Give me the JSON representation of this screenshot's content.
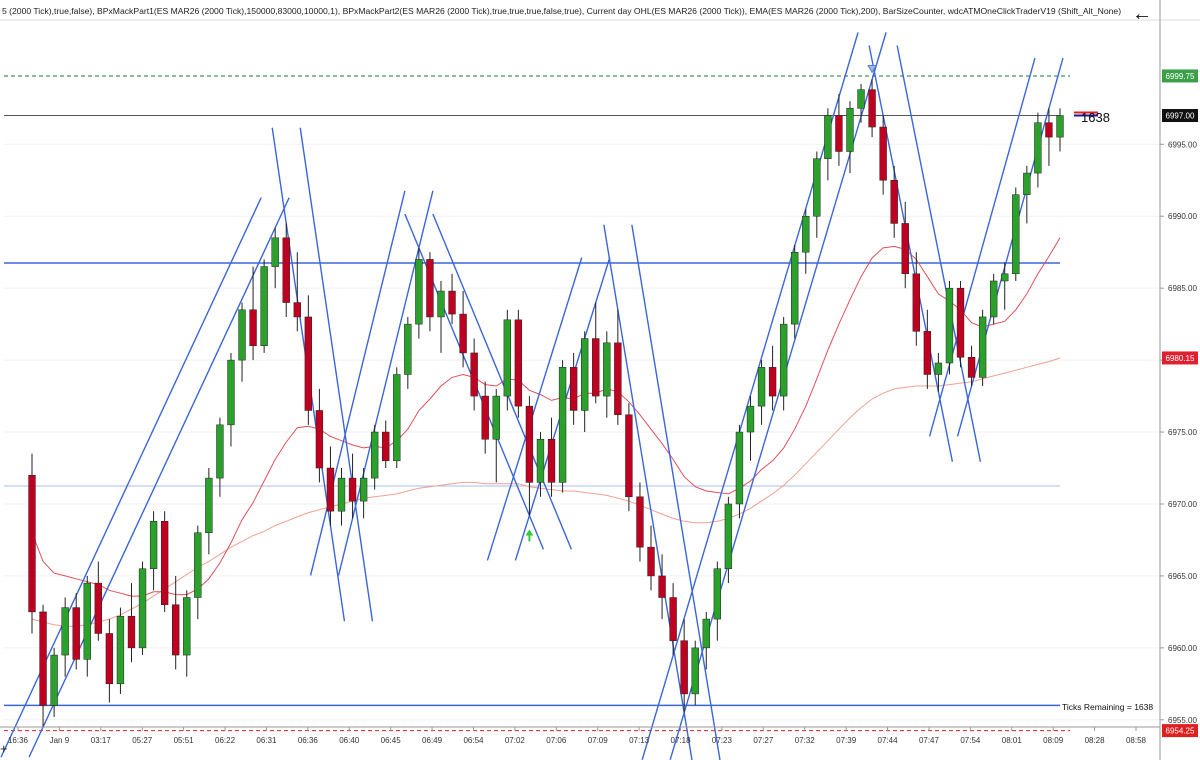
{
  "header": {
    "indicators_text": "5 (2000 Tick),true,false), BPxMackPart1(ES MAR26 (2000 Tick),150000,83000,10000,1), BPxMackPart2(ES MAR26 (2000 Tick),true,true,true,false,true), Current day OHL(ES MAR26 (2000 Tick)), EMA(ES MAR26 (2000 Tick),200), BarSizeCounter, wdcATMOneClickTraderV19 (Shift_Alt_None)"
  },
  "nav": {
    "back_icon": "arrow-left-icon",
    "back_glyph": "←"
  },
  "corner": {
    "glyph": "+"
  },
  "bar_counter": {
    "value": "1638",
    "ticks_remaining_text": "Ticks Remaining = 1638"
  },
  "colors": {
    "up_candle": "#2ca02c",
    "down_candle": "#c00020",
    "wick": "#222222",
    "trend_line": "#3a66d8",
    "ema_fast": "#e0505a",
    "ema_slow": "#f0a090",
    "level_green": "#1a7a2a",
    "level_red": "#e02020",
    "last_price_bg": "#111111",
    "high_label_bg": "#3aa048",
    "low_label_bg": "#e02020",
    "ema_label_bg": "#e02030"
  },
  "chart_data": {
    "type": "candlestick",
    "instrument": "ES MAR26 (2000 Tick)",
    "ylim": [
      6954.5,
      7003.5
    ],
    "y_ticks": [
      6955,
      6960,
      6965,
      6970,
      6975,
      6980,
      6985,
      6990,
      6995
    ],
    "y_tick_labels": [
      "6955.00",
      "6960.00",
      "6965.00",
      "6970.00",
      "6975.00",
      "6980.00",
      "6985.00",
      "6990.00",
      "6995.00"
    ],
    "x_labels": [
      "16:36",
      "Jan 9",
      "03:17",
      "05:27",
      "05:51",
      "06:22",
      "06:31",
      "06:36",
      "06:40",
      "06:45",
      "06:49",
      "06:54",
      "07:02",
      "07:06",
      "07:09",
      "07:13",
      "07:18",
      "07:23",
      "07:27",
      "07:32",
      "07:39",
      "07:44",
      "07:47",
      "07:54",
      "08:01",
      "08:09",
      "08:28",
      "08:58"
    ],
    "price_labels": [
      {
        "value": 6999.75,
        "text": "6999.75",
        "kind": "high"
      },
      {
        "value": 6997.0,
        "text": "6997.00",
        "kind": "last"
      },
      {
        "value": 6980.15,
        "text": "6980.15",
        "kind": "ema"
      },
      {
        "value": 6954.25,
        "text": "6954.25",
        "kind": "low"
      }
    ],
    "horizontal_levels": [
      {
        "value": 6997.0,
        "color": "#555555",
        "style": "solid"
      },
      {
        "value": 6999.75,
        "color": "#1a7a2a",
        "style": "dashed"
      },
      {
        "value": 6954.25,
        "color": "#e02020",
        "style": "dashed"
      },
      {
        "value": 6986.75,
        "color": "#3a66d8",
        "style": "solid"
      },
      {
        "value": 6956.0,
        "color": "#3a66d8",
        "style": "solid"
      },
      {
        "value": 6971.25,
        "color": "#a8bce8",
        "style": "solid"
      }
    ],
    "candles": [
      [
        6972,
        6973.5,
        6961,
        6962.5
      ],
      [
        6962.5,
        6963,
        6954.5,
        6956
      ],
      [
        6956,
        6960,
        6955.2,
        6959.5
      ],
      [
        6959.5,
        6963.5,
        6958,
        6962.8
      ],
      [
        6962.8,
        6963.8,
        6958.5,
        6959.2
      ],
      [
        6959.2,
        6965,
        6958,
        6964.5
      ],
      [
        6964.5,
        6966,
        6960.5,
        6961
      ],
      [
        6961,
        6962,
        6956.2,
        6957.5
      ],
      [
        6957.5,
        6962.8,
        6956.8,
        6962.2
      ],
      [
        6962.2,
        6964.5,
        6959,
        6960
      ],
      [
        6960,
        6966,
        6959.5,
        6965.5
      ],
      [
        6965.5,
        6969.5,
        6964,
        6968.8
      ],
      [
        6968.8,
        6969.5,
        6962.5,
        6963
      ],
      [
        6963,
        6965,
        6958.5,
        6959.5
      ],
      [
        6959.5,
        6964,
        6958,
        6963.5
      ],
      [
        6963.5,
        6968.5,
        6962,
        6968
      ],
      [
        6968,
        6972.5,
        6966.5,
        6971.8
      ],
      [
        6971.8,
        6976,
        6970.5,
        6975.5
      ],
      [
        6975.5,
        6980.5,
        6974,
        6980
      ],
      [
        6980,
        6984,
        6978.5,
        6983.5
      ],
      [
        6983.5,
        6986.5,
        6980,
        6981
      ],
      [
        6981,
        6987,
        6980.5,
        6986.5
      ],
      [
        6986.5,
        6989.2,
        6985,
        6988.5
      ],
      [
        6988.5,
        6989.5,
        6983,
        6984
      ],
      [
        6984,
        6987.5,
        6982,
        6983
      ],
      [
        6983,
        6984.5,
        6975.5,
        6976.5
      ],
      [
        6976.5,
        6978,
        6971.5,
        6972.5
      ],
      [
        6972.5,
        6974,
        6968.5,
        6969.5
      ],
      [
        6969.5,
        6972.5,
        6968.5,
        6971.8
      ],
      [
        6971.8,
        6973.5,
        6969,
        6970.2
      ],
      [
        6970.2,
        6972.5,
        6969,
        6971.8
      ],
      [
        6971.8,
        6975.5,
        6971,
        6975
      ],
      [
        6975,
        6975.8,
        6972.5,
        6973
      ],
      [
        6973,
        6979.5,
        6972.5,
        6979
      ],
      [
        6979,
        6983,
        6978,
        6982.5
      ],
      [
        6982.5,
        6987.8,
        6981.5,
        6987
      ],
      [
        6987,
        6987.5,
        6982,
        6983
      ],
      [
        6983,
        6985.5,
        6980.5,
        6984.8
      ],
      [
        6984.8,
        6986,
        6982.5,
        6983.2
      ],
      [
        6983.2,
        6984.8,
        6979.5,
        6980.5
      ],
      [
        6980.5,
        6981.5,
        6976.5,
        6977.5
      ],
      [
        6977.5,
        6978.5,
        6973.5,
        6974.5
      ],
      [
        6974.5,
        6978,
        6971.5,
        6977.5
      ],
      [
        6977.5,
        6983.5,
        6976.5,
        6982.8
      ],
      [
        6982.8,
        6983.5,
        6976,
        6976.8
      ],
      [
        6976.8,
        6977.5,
        6969.2,
        6971.5
      ],
      [
        6971.5,
        6975,
        6970.5,
        6974.5
      ],
      [
        6974.5,
        6976,
        6970.5,
        6971.5
      ],
      [
        6971.5,
        6980,
        6970.8,
        6979.5
      ],
      [
        6979.5,
        6980.5,
        6975.5,
        6976.5
      ],
      [
        6976.5,
        6982,
        6975,
        6981.5
      ],
      [
        6981.5,
        6984,
        6977,
        6977.5
      ],
      [
        6977.5,
        6982,
        6976,
        6981.2
      ],
      [
        6981.2,
        6983.5,
        6975.5,
        6976.2
      ],
      [
        6976.2,
        6977,
        6969.5,
        6970.5
      ],
      [
        6970.5,
        6971.5,
        6966,
        6967
      ],
      [
        6967,
        6968.5,
        6964,
        6965
      ],
      [
        6965,
        6966.5,
        6962,
        6963.5
      ],
      [
        6963.5,
        6964.5,
        6959.5,
        6960.5
      ],
      [
        6960.5,
        6962,
        6955.5,
        6956.8
      ],
      [
        6956.8,
        6960.5,
        6956,
        6960
      ],
      [
        6960,
        6962.5,
        6958.5,
        6962
      ],
      [
        6962,
        6966,
        6960.5,
        6965.5
      ],
      [
        6965.5,
        6970.5,
        6964.5,
        6970
      ],
      [
        6970,
        6975.5,
        6969,
        6975
      ],
      [
        6975,
        6977.5,
        6973,
        6976.8
      ],
      [
        6976.8,
        6980,
        6975.5,
        6979.5
      ],
      [
        6979.5,
        6981,
        6976.5,
        6977.5
      ],
      [
        6977.5,
        6983,
        6976.5,
        6982.5
      ],
      [
        6982.5,
        6988,
        6981.5,
        6987.5
      ],
      [
        6987.5,
        6990.5,
        6986,
        6990
      ],
      [
        6990,
        6994.5,
        6988.5,
        6994
      ],
      [
        6994,
        6997.5,
        6992.5,
        6997
      ],
      [
        6997,
        6998.5,
        6993.5,
        6994.5
      ],
      [
        6994.5,
        6998,
        6993,
        6997.5
      ],
      [
        6997.5,
        6999.2,
        6996.5,
        6998.8
      ],
      [
        6998.8,
        6999.5,
        6995.5,
        6996.2
      ],
      [
        6996.2,
        6997,
        6991.5,
        6992.5
      ],
      [
        6992.5,
        6993.5,
        6988.5,
        6989.5
      ],
      [
        6989.5,
        6991,
        6985,
        6986
      ],
      [
        6986,
        6987.5,
        6981,
        6982
      ],
      [
        6982,
        6983.5,
        6978,
        6979
      ],
      [
        6979,
        6980.5,
        6977.8,
        6979.8
      ],
      [
        6979.8,
        6985.5,
        6979,
        6985
      ],
      [
        6985,
        6985.5,
        6979.5,
        6980.2
      ],
      [
        6980.2,
        6981,
        6978.2,
        6978.8
      ],
      [
        6978.8,
        6983.5,
        6978.2,
        6983
      ],
      [
        6983,
        6986,
        6982.5,
        6985.5
      ],
      [
        6985.5,
        6986.8,
        6983.5,
        6986
      ],
      [
        6986,
        6992,
        6985.5,
        6991.5
      ],
      [
        6991.5,
        6993.5,
        6989.5,
        6993
      ],
      [
        6993,
        6997.2,
        6992,
        6996.5
      ],
      [
        6996.5,
        6997.5,
        6993.5,
        6995.5
      ],
      [
        6995.5,
        6997.5,
        6994.5,
        6997
      ]
    ],
    "ema_fast": [
      6968,
      6966,
      6965.2,
      6965,
      6964.8,
      6964.6,
      6964.4,
      6964,
      6963.8,
      6963.6,
      6963.6,
      6963.9,
      6963.9,
      6963.7,
      6963.7,
      6964.1,
      6964.8,
      6965.9,
      6967.3,
      6968.9,
      6970.1,
      6971.6,
      6973.1,
      6974.3,
      6975.3,
      6975.4,
      6975.2,
      6974.7,
      6974.4,
      6974.1,
      6973.9,
      6974,
      6973.9,
      6974.4,
      6975.2,
      6976.5,
      6977.3,
      6978.2,
      6978.8,
      6979,
      6978.8,
      6978.3,
      6978.2,
      6978.7,
      6978.6,
      6977.9,
      6977.6,
      6977.2,
      6977.4,
      6977.3,
      6977.7,
      6977.7,
      6978,
      6977.8,
      6977.1,
      6976.2,
      6975.2,
      6974.2,
      6973.1,
      6971.9,
      6971.2,
      6970.9,
      6970.8,
      6970.7,
      6971.1,
      6971.6,
      6972.4,
      6973,
      6973.9,
      6975.2,
      6976.8,
      6978.7,
      6980.7,
      6982.5,
      6984.2,
      6985.8,
      6987.1,
      6987.8,
      6987.9,
      6987.7,
      6987,
      6985.8,
      6984.6,
      6984.1,
      6983.5,
      6982.6,
      6982.3,
      6982.5,
      6982.7,
      6983.5,
      6984.6,
      6986,
      6987.2,
      6988.5
    ],
    "ema_slow": [
      6962,
      6961.8,
      6961.6,
      6961.5,
      6961.5,
      6961.6,
      6961.8,
      6962,
      6962.3,
      6962.7,
      6963.1,
      6963.6,
      6964.1,
      6964.6,
      6965.1,
      6965.6,
      6966,
      6966.5,
      6967,
      6967.4,
      6967.8,
      6968.1,
      6968.5,
      6968.8,
      6969.1,
      6969.4,
      6969.6,
      6969.8,
      6970,
      6970.2,
      6970.4,
      6970.5,
      6970.6,
      6970.7,
      6970.9,
      6971.1,
      6971.2,
      6971.3,
      6971.4,
      6971.5,
      6971.5,
      6971.4,
      6971.4,
      6971.4,
      6971.4,
      6971.2,
      6971.1,
      6971,
      6970.9,
      6970.9,
      6970.8,
      6970.7,
      6970.6,
      6970.4,
      6970.2,
      6969.9,
      6969.6,
      6969.3,
      6969,
      6968.8,
      6968.7,
      6968.7,
      6968.8,
      6969,
      6969.3,
      6969.7,
      6970.2,
      6970.7,
      6971.3,
      6972,
      6972.8,
      6973.6,
      6974.4,
      6975.2,
      6976,
      6976.7,
      6977.3,
      6977.7,
      6978,
      6978.1,
      6978.2,
      6978.2,
      6978.2,
      6978.3,
      6978.4,
      6978.5,
      6978.7,
      6978.9,
      6979.1,
      6979.3,
      6979.5,
      6979.7,
      6979.9,
      6980.15
    ]
  }
}
